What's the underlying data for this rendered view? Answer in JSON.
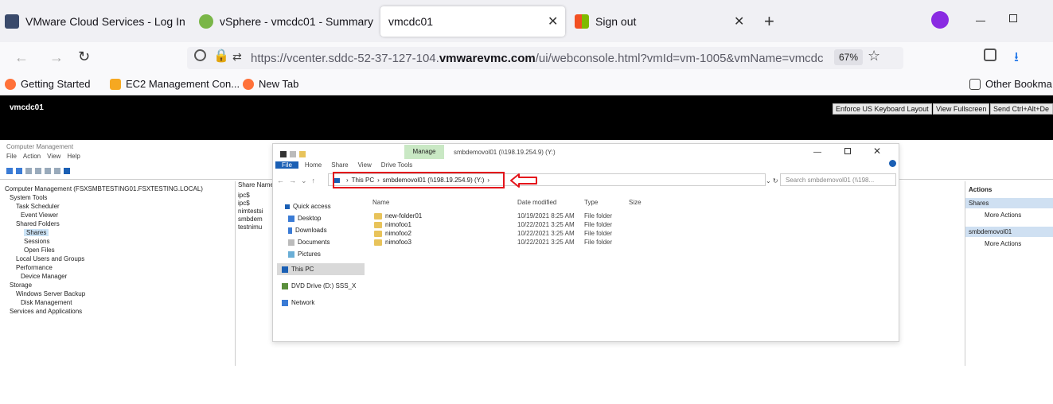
{
  "browser": {
    "tabs": [
      {
        "label": "VMware Cloud Services - Log In ✕",
        "favicon_color": "#3a4a6b"
      },
      {
        "label": "vSphere - vmcdc01 - Summary ✕",
        "favicon_color": "#7ab648"
      },
      {
        "label": "vmcdc01",
        "favicon_color": ""
      },
      {
        "label": "Sign out",
        "favicon_color": "#f25022"
      }
    ],
    "tab3_close": "✕",
    "tab4_close": "✕",
    "new_tab": "+",
    "url_prefix": "https://vcenter.sddc-52-37-127-104.",
    "url_domain": "vmwarevmc.com",
    "url_suffix": "/ui/webconsole.html?vmId=vm-1005&vmName=vmcdc",
    "zoom": "67%",
    "bookmarks": [
      "Getting Started",
      "EC2 Management Con...",
      "New Tab"
    ],
    "other_bookmarks": "Other Bookma"
  },
  "console": {
    "vm_name": "vmcdc01",
    "btn_keyboard": "Enforce US Keyboard Layout",
    "btn_fullscreen": "View Fullscreen",
    "btn_cad": "Send Ctrl+Alt+De"
  },
  "compmgmt": {
    "title": "Computer Management",
    "menu": [
      "File",
      "Action",
      "View",
      "Help"
    ],
    "tree": [
      "Computer Management (FSXSMBTESTING01.FSXTESTING.LOCAL)",
      "System Tools",
      "Task Scheduler",
      "Event Viewer",
      "Shared Folders",
      "Shares",
      "Sessions",
      "Open Files",
      "Local Users and Groups",
      "Performance",
      "Device Manager",
      "Storage",
      "Windows Server Backup",
      "Disk Management",
      "Services and Applications"
    ],
    "share_header": "Share Name",
    "shares": [
      "ipc$",
      "ipc$",
      "nimtestsi",
      "smbdem",
      "testnimu"
    ],
    "actions_header": "Actions",
    "actions": [
      "Shares",
      "More Actions",
      "smbdemovol01",
      "More Actions"
    ]
  },
  "explorer": {
    "ribbon_manage": "Manage",
    "window_title": "smbdemovol01 (\\\\198.19.254.9) (Y:)",
    "ribbon_tabs": [
      "File",
      "Home",
      "Share",
      "View",
      "Drive Tools"
    ],
    "breadcrumb": [
      "This PC",
      "smbdemovol01 (\\\\198.19.254.9) (Y:)"
    ],
    "search_placeholder": "Search smbdemovol01 (\\\\198...",
    "nav": [
      "Quick access",
      "Desktop",
      "Downloads",
      "Documents",
      "Pictures",
      "This PC",
      "DVD Drive (D:) SSS_X",
      "Network"
    ],
    "columns": [
      "Name",
      "Date modified",
      "Type",
      "Size"
    ],
    "rows": [
      {
        "name": "new-folder01",
        "date": "10/19/2021 8:25 AM",
        "type": "File folder"
      },
      {
        "name": "nimofoo1",
        "date": "10/22/2021 3:25 AM",
        "type": "File folder"
      },
      {
        "name": "nimofoo2",
        "date": "10/22/2021 3:25 AM",
        "type": "File folder"
      },
      {
        "name": "nimofoo3",
        "date": "10/22/2021 3:25 AM",
        "type": "File folder"
      }
    ]
  },
  "colors": {
    "highlight": "#e4141b",
    "accent_blue": "#1a5fb4"
  }
}
